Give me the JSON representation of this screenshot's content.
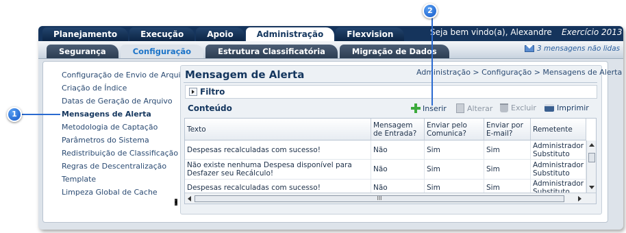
{
  "top_tabs": [
    {
      "label": "Planejamento",
      "active": false
    },
    {
      "label": "Execução",
      "active": false
    },
    {
      "label": "Apoio",
      "active": false
    },
    {
      "label": "Administração",
      "active": true
    },
    {
      "label": "Flexvision",
      "active": false
    }
  ],
  "welcome_text": "Seja bem vindo(a), Alexandre",
  "exercicio_text": "Exercício 2013",
  "sub_tabs": [
    {
      "label": "Segurança",
      "active": false
    },
    {
      "label": "Configuração",
      "active": true
    },
    {
      "label": "Estrutura Classificatória",
      "active": false
    },
    {
      "label": "Migração de Dados",
      "active": false
    }
  ],
  "messages_text": "3 mensagens não lidas",
  "sidebar": {
    "items": [
      {
        "label": "Configuração de Envio de Arquivo",
        "selected": false
      },
      {
        "label": "Criação de Índice",
        "selected": false
      },
      {
        "label": "Datas de Geração de Arquivo",
        "selected": false
      },
      {
        "label": "Mensagens de Alerta",
        "selected": true
      },
      {
        "label": "Metodologia de Captação",
        "selected": false
      },
      {
        "label": "Parâmetros do Sistema",
        "selected": false
      },
      {
        "label": "Redistribuição de Classificação",
        "selected": false
      },
      {
        "label": "Regras de Descentralização",
        "selected": false
      },
      {
        "label": "Template",
        "selected": false
      },
      {
        "label": "Limpeza Global de Cache",
        "selected": false
      }
    ]
  },
  "page_title": "Mensagem de Alerta",
  "breadcrumb": "Administração > Configuração > Mensagens de Alerta",
  "filter_label": "Filtro",
  "content_label": "Conteúdo",
  "toolbar": {
    "insert": "Inserir",
    "edit": "Alterar",
    "delete": "Excluir",
    "print": "Imprimir"
  },
  "table": {
    "headers": [
      "Texto",
      "Mensagem de Entrada?",
      "Enviar pelo Comunica?",
      "Enviar por E-mail?",
      "Remetente"
    ],
    "rows": [
      [
        "Despesas recalculadas com sucesso!",
        "Não",
        "Sim",
        "Sim",
        "Administrador Substituto"
      ],
      [
        "Não existe nenhuma Despesa disponível para Desfazer seu Recálculo!",
        "Não",
        "Sim",
        "Sim",
        "Administrador Substituto"
      ],
      [
        "Despesas recalculadas com sucesso!",
        "Não",
        "Sim",
        "Sim",
        "Administrador Substituto"
      ]
    ]
  },
  "scrollbar_grip": "III",
  "callouts": [
    "1",
    "2"
  ],
  "colors": {
    "navy": "#15345c",
    "accent_blue": "#1c74c8",
    "callout_blue": "#1459c9",
    "insert_green": "#3caa3c"
  }
}
